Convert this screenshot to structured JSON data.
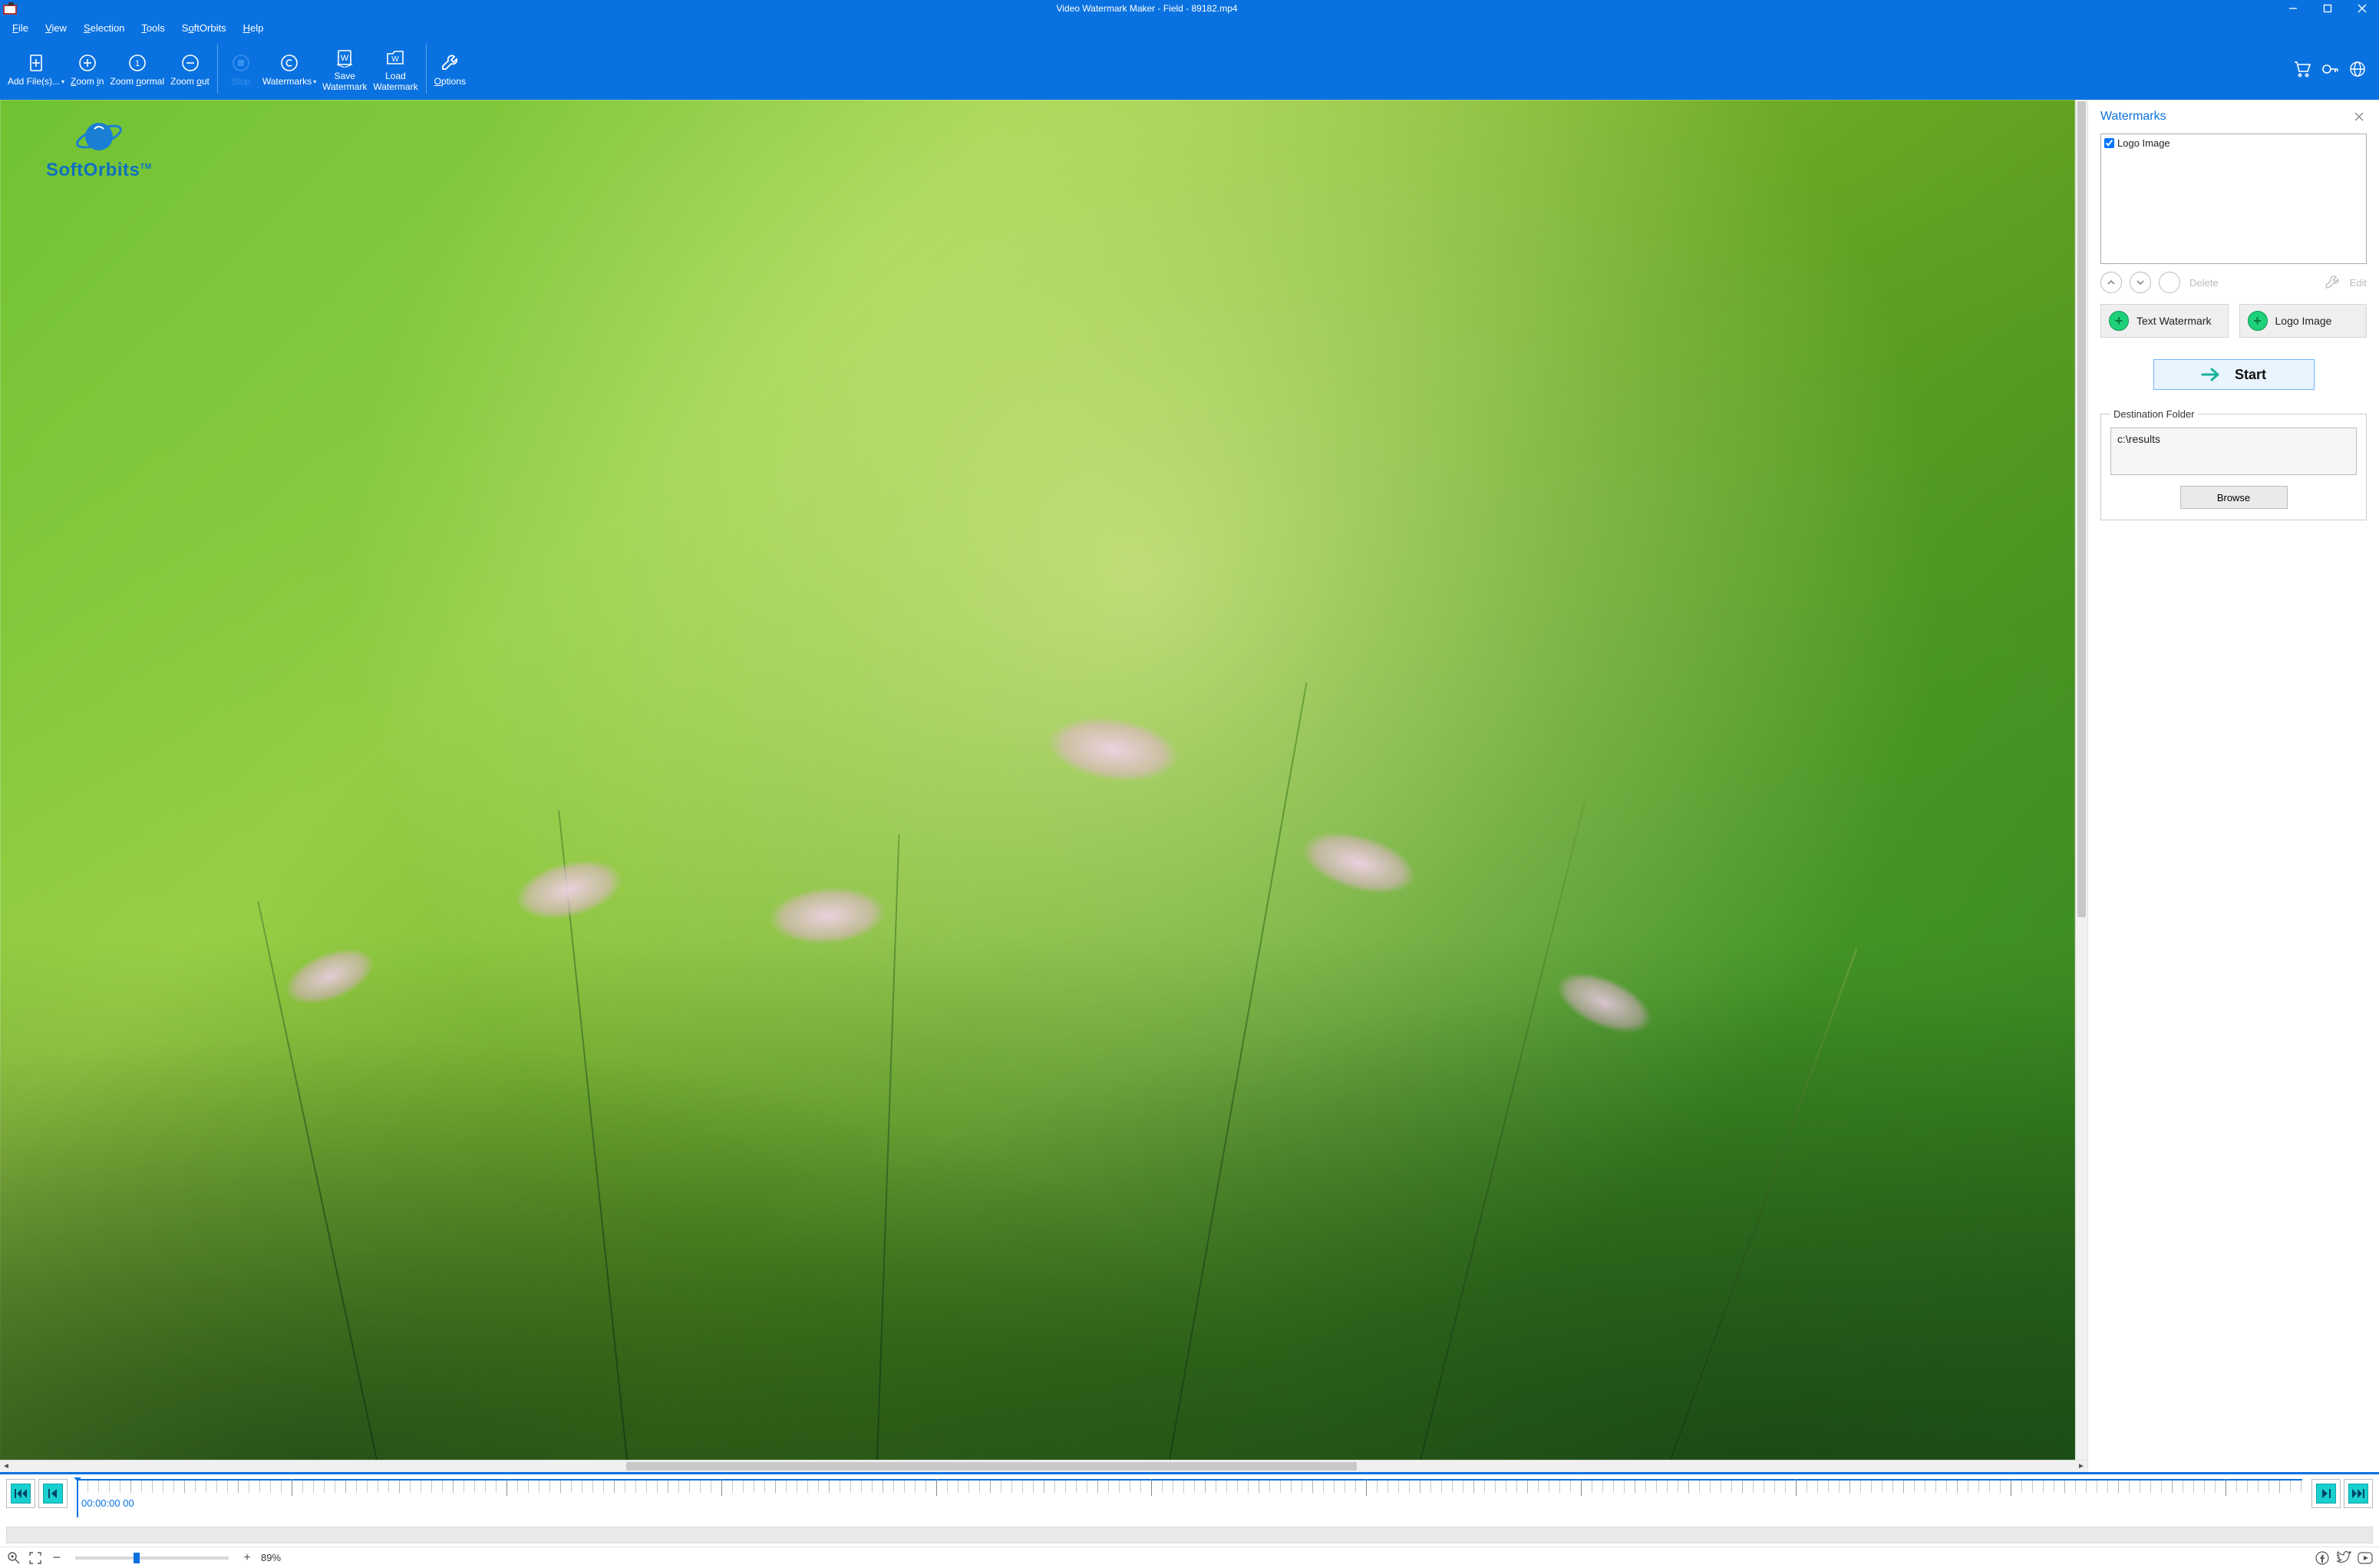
{
  "title": "Video Watermark Maker - Field - 89182.mp4",
  "menus": [
    "File",
    "View",
    "Selection",
    "Tools",
    "SoftOrbits",
    "Help"
  ],
  "toolbar": {
    "add_files": "Add File(s)...",
    "zoom_in": "Zoom in",
    "zoom_normal": "Zoom normal",
    "zoom_out": "Zoom out",
    "stop": "Stop",
    "watermarks": "Watermarks",
    "save_wm": "Save Watermark",
    "load_wm": "Load Watermark",
    "options": "Options"
  },
  "overlay": {
    "brand": "SoftOrbits",
    "tm": "TM"
  },
  "panel": {
    "title": "Watermarks",
    "items": [
      {
        "label": "Logo Image",
        "checked": true
      }
    ],
    "delete": "Delete",
    "edit": "Edit",
    "text_wm": "Text Watermark",
    "logo_img": "Logo Image",
    "start": "Start",
    "dest_legend": "Destination Folder",
    "dest_path": "c:\\results",
    "browse": "Browse"
  },
  "timeline": {
    "timecode": "00:00:00 00"
  },
  "status": {
    "zoom_pct": "89%"
  }
}
